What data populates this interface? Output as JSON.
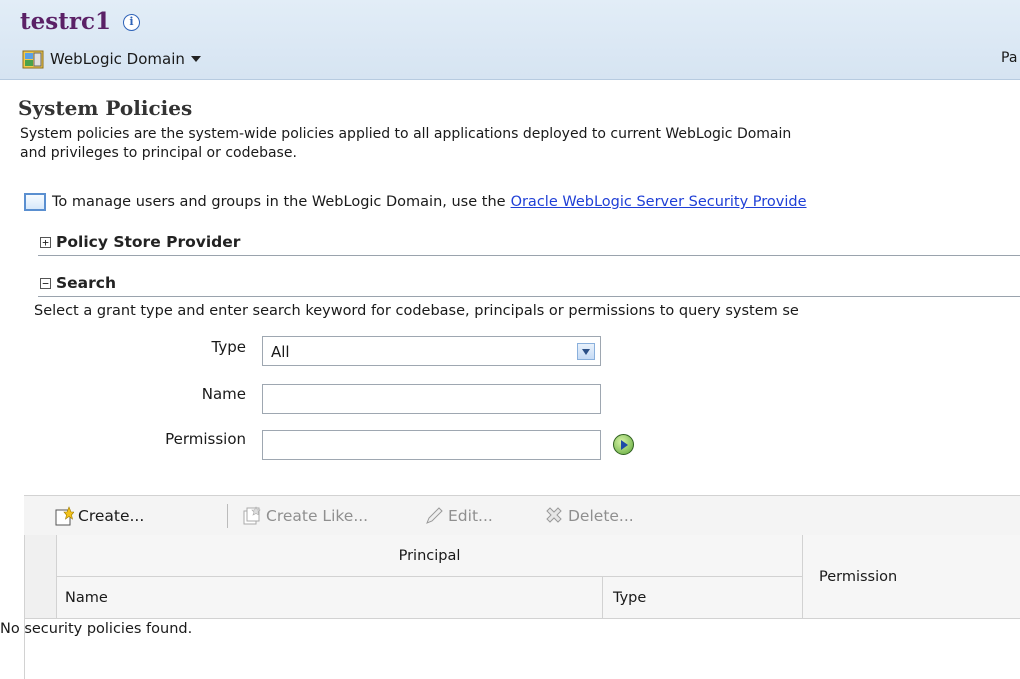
{
  "header": {
    "title": "testrc1",
    "domain_menu": "WebLogic Domain",
    "cut_text": "Pa"
  },
  "page": {
    "heading": "System Policies",
    "description_line1": "System policies are the system-wide policies applied to all applications deployed to current WebLogic Domain",
    "description_line2": "and privileges to principal or codebase.",
    "manage_text": "To manage users and groups in the WebLogic Domain, use the",
    "manage_link": "Oracle WebLogic Server Security Provide"
  },
  "sections": {
    "policy_store": {
      "label": "Policy Store Provider",
      "toggle": "+",
      "expanded": false
    },
    "search": {
      "label": "Search",
      "toggle": "−",
      "expanded": true,
      "help": "Select a grant type and enter search keyword for codebase, principals or permissions to query system se"
    }
  },
  "search_form": {
    "type_label": "Type",
    "type_value": "All",
    "name_label": "Name",
    "name_value": "",
    "permission_label": "Permission",
    "permission_value": ""
  },
  "toolbar": {
    "create": "Create...",
    "create_like": "Create Like...",
    "edit": "Edit...",
    "delete": "Delete..."
  },
  "table": {
    "group_header": "Principal",
    "columns": {
      "name": "Name",
      "type": "Type",
      "permission": "Permission"
    },
    "empty_message": "No security policies found."
  },
  "colors": {
    "title": "#5b2166",
    "link": "#1f3fd6",
    "header_bg": "#d6e4f2"
  }
}
